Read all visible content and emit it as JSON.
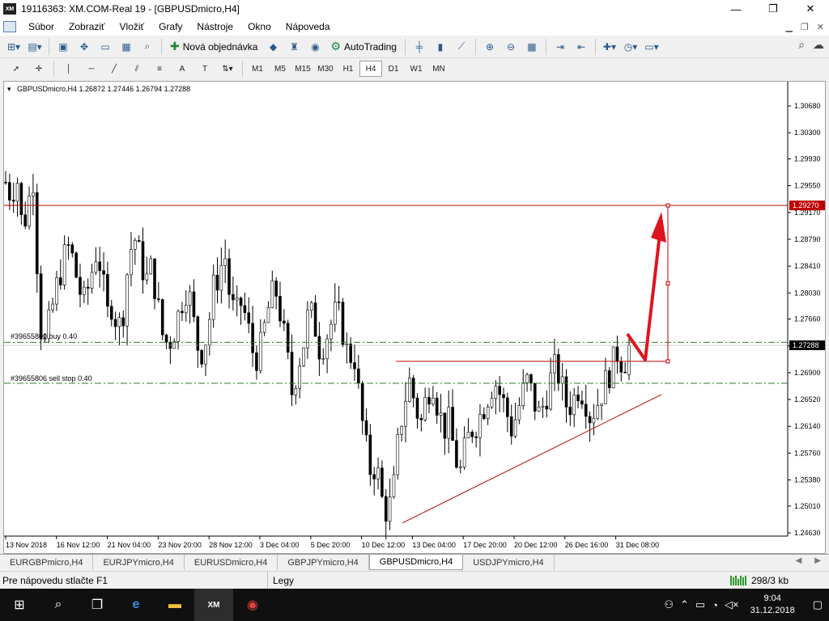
{
  "window": {
    "title": "19116363: XM.COM-Real 19 - [GBPUSDmicro,H4]",
    "logo": "XM",
    "minimize": "—",
    "maximize": "❐",
    "close": "✕"
  },
  "menu": [
    "Súbor",
    "Zobraziť",
    "Vložiť",
    "Grafy",
    "Nástroje",
    "Okno",
    "Nápoveda"
  ],
  "toolbar": {
    "new_order": "Nová objednávka",
    "autotrading": "AutoTrading"
  },
  "timeframes": [
    "M1",
    "M5",
    "M15",
    "M30",
    "H1",
    "H4",
    "D1",
    "W1",
    "MN"
  ],
  "active_timeframe": "H4",
  "chart": {
    "header": "GBPUSDmicro,H4  1.26872 1.27446 1.26794 1.27288",
    "price_labels": [
      "1.30680",
      "1.30300",
      "1.29930",
      "1.29550",
      "1.29170",
      "1.28790",
      "1.28410",
      "1.28030",
      "1.27660",
      "1.27280",
      "1.26900",
      "1.26520",
      "1.26140",
      "1.25760",
      "1.25380",
      "1.25010",
      "1.24630"
    ],
    "date_labels": [
      "13 Nov 2018",
      "16 Nov 12:00",
      "21 Nov 04:00",
      "23 Nov 20:00",
      "28 Nov 12:00",
      "3 Dec 04:00",
      "5 Dec 20:00",
      "10 Dec 12:00",
      "13 Dec 04:00",
      "17 Dec 20:00",
      "20 Dec 12:00",
      "26 Dec 16:00",
      "31 Dec 08:00"
    ],
    "current_price": "1.27288",
    "target_price": "1.29270",
    "order_buy": "#39655800 buy 0.40",
    "order_sell": "#39655806 sell stop 0.40",
    "colors": {
      "price_line": "#c00000",
      "order_line": "#2e7d32",
      "arrow": "#e0141e",
      "candle": "#000000"
    }
  },
  "chart_data": {
    "type": "candlestick",
    "symbol": "GBPUSDmicro",
    "timeframe": "H4",
    "ylim": [
      1.2463,
      1.3068
    ],
    "ohlc_last": {
      "open": 1.26872,
      "high": 1.27446,
      "low": 1.26794,
      "close": 1.27288
    },
    "close_profile": [
      1.296,
      1.294,
      1.297,
      1.289,
      1.293,
      1.297,
      1.276,
      1.273,
      1.277,
      1.281,
      1.284,
      1.287,
      1.285,
      1.281,
      1.279,
      1.282,
      1.286,
      1.284,
      1.277,
      1.279,
      1.275,
      1.278,
      1.286,
      1.288,
      1.285,
      1.282,
      1.284,
      1.279,
      1.274,
      1.273,
      1.275,
      1.278,
      1.281,
      1.279,
      1.273,
      1.272,
      1.275,
      1.281,
      1.283,
      1.286,
      1.279,
      1.277,
      1.279,
      1.276,
      1.272,
      1.271,
      1.275,
      1.279,
      1.281,
      1.277,
      1.272,
      1.266,
      1.27,
      1.273,
      1.278,
      1.276,
      1.272,
      1.274,
      1.276,
      1.278,
      1.275,
      1.271,
      1.272,
      1.265,
      1.259,
      1.255,
      1.256,
      1.251,
      1.249,
      1.252,
      1.26,
      1.265,
      1.268,
      1.264,
      1.262,
      1.266,
      1.268,
      1.264,
      1.261,
      1.262,
      1.257,
      1.255,
      1.259,
      1.261,
      1.262,
      1.264,
      1.266,
      1.268,
      1.266,
      1.264,
      1.261,
      1.263,
      1.266,
      1.268,
      1.265,
      1.263,
      1.265,
      1.268,
      1.27,
      1.267,
      1.264,
      1.265,
      1.267,
      1.266,
      1.263,
      1.264,
      1.266,
      1.268,
      1.27,
      1.272,
      1.27,
      1.273
    ],
    "lines": {
      "resistance": 1.2706,
      "target": 1.2927,
      "buy_order": 1.2733,
      "sell_stop": 1.2675,
      "trendline": {
        "from": {
          "date": "10 Dec 12:00",
          "price": 1.2477
        },
        "to": {
          "date": "31 Dec 08:00",
          "price": 1.2659
        }
      }
    }
  },
  "tabs": [
    "EURGBPmicro,H4",
    "EURJPYmicro,H4",
    "EURUSDmicro,H4",
    "GBPJPYmicro,H4",
    "GBPUSDmicro,H4",
    "USDJPYmicro,H4"
  ],
  "active_tab": "GBPUSDmicro,H4",
  "status": {
    "help": "Pre nápovedu stlačte F1",
    "profile": "Legy",
    "connection": "298/3 kb"
  },
  "taskbar": {
    "time": "9:04",
    "date": "31.12.2018"
  }
}
